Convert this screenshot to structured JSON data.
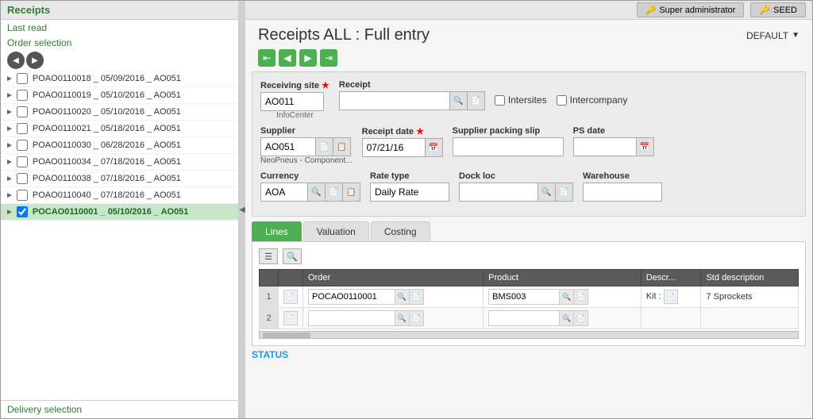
{
  "topbar": {
    "admin_label": "Super administrator",
    "seed_label": "SEED"
  },
  "sidebar": {
    "title": "Receipts",
    "last_read_label": "Last read",
    "order_selection_label": "Order selection",
    "items": [
      {
        "id": "POAO0110018_05092016_AO051",
        "label": "POAO0110018 _ 05/09/2016 _ AO051",
        "selected": false,
        "checked": false
      },
      {
        "id": "POAO0110019_05102016_AO051",
        "label": "POAO0110019 _ 05/10/2016 _ AO051",
        "selected": false,
        "checked": false
      },
      {
        "id": "POAO0110020_05102016_AO051",
        "label": "POAO0110020 _ 05/10/2016 _ AO051",
        "selected": false,
        "checked": false
      },
      {
        "id": "POAO0110021_05182016_AO051",
        "label": "POAO0110021 _ 05/18/2016 _ AO051",
        "selected": false,
        "checked": false
      },
      {
        "id": "POAO0110030_06282016_AO051",
        "label": "POAO0110030 _ 06/28/2016 _ AO051",
        "selected": false,
        "checked": false
      },
      {
        "id": "POAO0110034_07182016_AO051",
        "label": "POAO0110034 _ 07/18/2016 _ AO051",
        "selected": false,
        "checked": false
      },
      {
        "id": "POAO0110038_07182016_AO051",
        "label": "POAO0110038 _ 07/18/2016 _ AO051",
        "selected": false,
        "checked": false
      },
      {
        "id": "POAO0110040_07182016_AO051",
        "label": "POAO0110040 _ 07/18/2016 _ AO051",
        "selected": false,
        "checked": false
      },
      {
        "id": "POCAO0110001_05102016_AO051",
        "label": "POCAO0110001 _ 05/10/2016 _ AO051",
        "selected": true,
        "checked": true
      }
    ],
    "delivery_selection_label": "Delivery selection"
  },
  "page": {
    "title": "Receipts ALL : Full entry",
    "env_label": "DEFAULT"
  },
  "nav_arrows": {
    "first": "&#8676;",
    "prev": "&#9664;",
    "next": "&#9654;",
    "last": "&#8677;"
  },
  "form": {
    "receiving_site_label": "Receiving site",
    "receiving_site_value": "AO011",
    "infocenter_label": "InfoCenter",
    "receipt_label": "Receipt",
    "receipt_value": "",
    "intersites_label": "Intersites",
    "intercompany_label": "Intercompany",
    "supplier_label": "Supplier",
    "supplier_value": "AO051",
    "supplier_sub": "NeoPneus - Component...",
    "receipt_date_label": "Receipt date",
    "receipt_date_value": "07/21/16",
    "supplier_packing_slip_label": "Supplier packing slip",
    "supplier_packing_slip_value": "",
    "ps_date_label": "PS date",
    "ps_date_value": "",
    "currency_label": "Currency",
    "currency_value": "AOA",
    "rate_type_label": "Rate type",
    "rate_type_value": "Daily Rate",
    "dock_loc_label": "Dock loc",
    "dock_loc_value": "",
    "warehouse_label": "Warehouse",
    "warehouse_value": ""
  },
  "tabs": {
    "items": [
      {
        "id": "lines",
        "label": "Lines",
        "active": true
      },
      {
        "id": "valuation",
        "label": "Valuation",
        "active": false
      },
      {
        "id": "costing",
        "label": "Costing",
        "active": false
      }
    ]
  },
  "table": {
    "columns": [
      {
        "id": "row_num",
        "label": ""
      },
      {
        "id": "doc",
        "label": ""
      },
      {
        "id": "order",
        "label": "Order"
      },
      {
        "id": "product",
        "label": "Product"
      },
      {
        "id": "description",
        "label": "Descr..."
      },
      {
        "id": "std_description",
        "label": "Std description"
      }
    ],
    "rows": [
      {
        "row_num": "1",
        "order": "POCAO0110001",
        "product": "BMS003",
        "description": "Kit :",
        "std_description": "7 Sprockets"
      },
      {
        "row_num": "2",
        "order": "",
        "product": "",
        "description": "",
        "std_description": ""
      }
    ]
  },
  "status": {
    "label": "STATUS"
  }
}
